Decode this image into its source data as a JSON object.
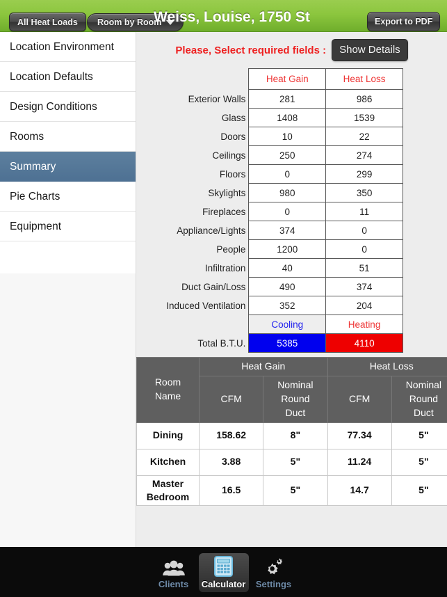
{
  "header": {
    "all_heat_loads_label": "All Heat Loads",
    "room_by_room_label": "Room by Room",
    "title": "Weiss, Louise, 1750 St",
    "export_label": "Export to PDF",
    "accent_green": "#8cc63e"
  },
  "sidebar": {
    "items": [
      {
        "label": "Location Environment",
        "selected": false
      },
      {
        "label": "Location Defaults",
        "selected": false
      },
      {
        "label": "Design Conditions",
        "selected": false
      },
      {
        "label": "Rooms",
        "selected": false
      },
      {
        "label": "Summary",
        "selected": true
      },
      {
        "label": "Pie Charts",
        "selected": false
      },
      {
        "label": "Equipment",
        "selected": false
      }
    ],
    "selected_color": "#527architecture"
  },
  "main": {
    "select_message": "Please, Select required fields :",
    "show_details_label": "Show Details"
  },
  "summary_table": {
    "columns": [
      "Heat Gain",
      "Heat Loss"
    ],
    "rows": [
      {
        "label": "Exterior Walls",
        "gain": "281",
        "loss": "986"
      },
      {
        "label": "Glass",
        "gain": "1408",
        "loss": "1539"
      },
      {
        "label": "Doors",
        "gain": "10",
        "loss": "22"
      },
      {
        "label": "Ceilings",
        "gain": "250",
        "loss": "274"
      },
      {
        "label": "Floors",
        "gain": "0",
        "loss": "299"
      },
      {
        "label": "Skylights",
        "gain": "980",
        "loss": "350"
      },
      {
        "label": "Fireplaces",
        "gain": "0",
        "loss": "11"
      },
      {
        "label": "Appliance/Lights",
        "gain": "374",
        "loss": "0"
      },
      {
        "label": "People",
        "gain": "1200",
        "loss": "0"
      },
      {
        "label": "Infiltration",
        "gain": "40",
        "loss": "51"
      },
      {
        "label": "Duct Gain/Loss",
        "gain": "490",
        "loss": "374"
      },
      {
        "label": "Induced Ventilation",
        "gain": "352",
        "loss": "204"
      }
    ],
    "mode_row": {
      "label": "",
      "cooling": "Cooling",
      "heating": "Heating"
    },
    "total_row": {
      "label": "Total B.T.U.",
      "cooling_value": "5385",
      "heating_value": "4110"
    },
    "cooling_color": "#0000ee",
    "heating_color": "#ee0000"
  },
  "room_table": {
    "group_headers": [
      "Heat Gain",
      "Heat Loss"
    ],
    "col_room_name": "Room\nName",
    "col_room_name_line1": "Room",
    "col_room_name_line2": "Name",
    "col_cfm": "CFM",
    "col_duct_line1": "Nominal",
    "col_duct_line2": "Round",
    "col_duct_line3": "Duct",
    "rows": [
      {
        "name": "Dining",
        "gain_cfm": "158.62",
        "gain_duct": "8\"",
        "loss_cfm": "77.34",
        "loss_duct": "5\""
      },
      {
        "name": "Kitchen",
        "gain_cfm": "3.88",
        "gain_duct": "5\"",
        "loss_cfm": "11.24",
        "loss_duct": "5\""
      },
      {
        "name": "Master Bedroom",
        "gain_cfm": "16.5",
        "gain_duct": "5\"",
        "loss_cfm": "14.7",
        "loss_duct": "5\""
      }
    ]
  },
  "tabbar": {
    "tabs": [
      {
        "label": "Clients",
        "icon": "people-icon",
        "active": false
      },
      {
        "label": "Calculator",
        "icon": "calculator-icon",
        "active": true
      },
      {
        "label": "Settings",
        "icon": "gears-icon",
        "active": false
      }
    ]
  }
}
